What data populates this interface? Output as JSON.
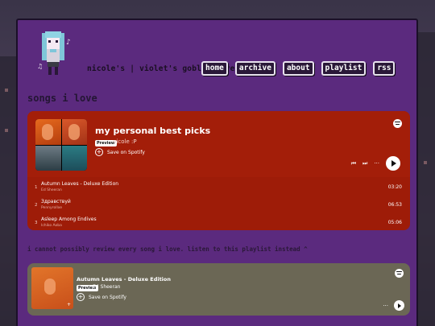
{
  "site": {
    "title": "nicole's | violet's goblin cove"
  },
  "nav": [
    {
      "label": "home"
    },
    {
      "label": "archive"
    },
    {
      "label": "about"
    },
    {
      "label": "playlist"
    },
    {
      "label": "rss"
    }
  ],
  "section": {
    "heading": "songs i love"
  },
  "playlist_embed": {
    "title": "my personal best picks",
    "badge": "Preview",
    "owner": "nicole :P",
    "save_label": "Save on Spotify",
    "more_label": "···",
    "tracks": [
      {
        "num": "1",
        "name": "Autumn Leaves - Deluxe Edition",
        "artist": "Ed Sheeran",
        "duration": "03:20"
      },
      {
        "num": "2",
        "name": "Здравствуй",
        "artist": "Pennyrollxe",
        "duration": "06:53"
      },
      {
        "num": "3",
        "name": "Asleep Among Endives",
        "artist": "Ichiko Aoba",
        "duration": "05:06"
      }
    ]
  },
  "review_note": "i cannot possibly review every song i love. listen to this playlist instead ^",
  "track_embed": {
    "title": "Autumn Leaves - Deluxe Edition",
    "badge": "Preview",
    "artist": "Ed Sheeran",
    "save_label": "Save on Spotify",
    "more_label": "···",
    "cover_mark": "+"
  },
  "colors": {
    "panel": "#5b2a7e",
    "playlist_embed_bg": "#9e1c08",
    "track_embed_bg": "#6b6755"
  }
}
